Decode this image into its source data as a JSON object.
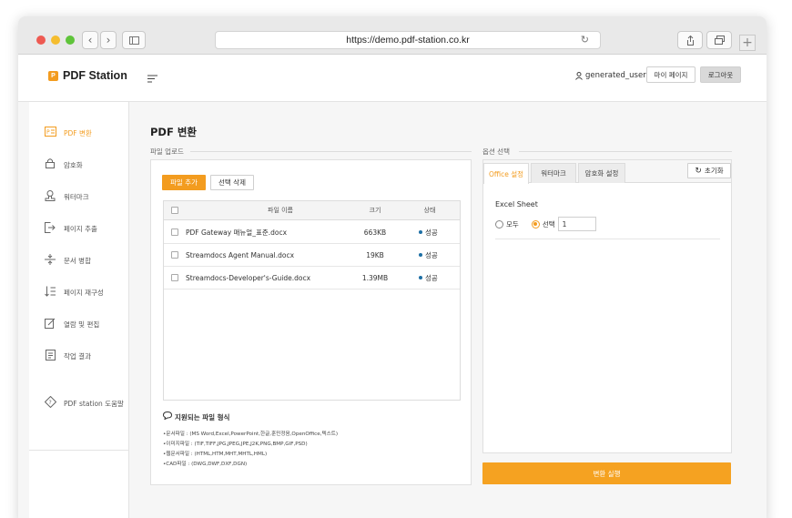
{
  "browser": {
    "url": "https://demo.pdf-station.co.kr"
  },
  "header": {
    "logo_text": "PDF Station",
    "username": "generated_user",
    "my_page": "마이 페이지",
    "logout": "로그아웃"
  },
  "sidebar": {
    "items": [
      {
        "label": "PDF 변환",
        "icon": "pdf-convert-icon",
        "active": true
      },
      {
        "label": "암호화",
        "icon": "lock-icon"
      },
      {
        "label": "워터마크",
        "icon": "watermark-icon"
      },
      {
        "label": "페이지 추출",
        "icon": "page-extract-icon"
      },
      {
        "label": "문서 병합",
        "icon": "merge-icon"
      },
      {
        "label": "페이지 재구성",
        "icon": "reorder-icon"
      },
      {
        "label": "열람 및 편집",
        "icon": "edit-icon"
      },
      {
        "label": "작업 결과",
        "icon": "result-icon"
      }
    ],
    "help": "PDF station 도움말"
  },
  "main": {
    "title": "PDF 변환",
    "upload_label": "파일 업로드",
    "options_label": "옵션 선택",
    "add_file": "파일 추가",
    "delete_selected": "선택 삭제",
    "table": {
      "columns": [
        "파일 이름",
        "크기",
        "상태"
      ],
      "rows": [
        {
          "name": "PDF Gateway 매뉴얼_표준.docx",
          "size": "663KB",
          "status": "성공"
        },
        {
          "name": "Streamdocs Agent Manual.docx",
          "size": "19KB",
          "status": "성공"
        },
        {
          "name": "Streamdocs-Developer's-Guide.docx",
          "size": "1.39MB",
          "status": "성공"
        }
      ]
    },
    "supported_title": "지원되는 파일 형식",
    "formats": [
      "•문서파일 : (MS Word,Excel,PowerPoint,한글,훈민정음,OpenOffice,텍스트)",
      "•이미지파일 : (TIF,TIFF,JPG,JPEG,JPE,J2K,PNG,BMP,GIF,PSD)",
      "•웹문서파일 : (HTML,HTM,MHT,MHTL,HML)",
      "•CAD파일 : (DWG,DWF,DXF,DGN)"
    ],
    "tabs": [
      "Office 설정",
      "워터마크",
      "암호화 설정"
    ],
    "reset": "초기화",
    "excel_title": "Excel Sheet",
    "radio_all": "모두",
    "radio_select": "선택",
    "sheet_value": "1",
    "convert": "변환 실행"
  },
  "colors": {
    "accent": "#f39c1f",
    "status_dot": "#1d6fa5"
  }
}
